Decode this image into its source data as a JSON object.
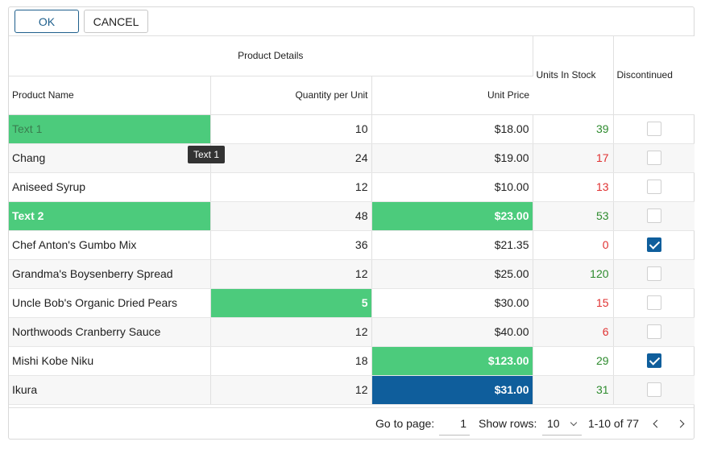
{
  "toolbar": {
    "ok_label": "OK",
    "cancel_label": "CANCEL"
  },
  "header": {
    "group_label": "Product Details",
    "columns": {
      "name": "Product Name",
      "qty": "Quantity per Unit",
      "price": "Unit Price",
      "stock": "Units In Stock",
      "discontinued": "Discontinued"
    }
  },
  "rows": [
    {
      "name": "Text 1",
      "qty": "10",
      "price": "$18.00",
      "stock": "39",
      "discontinued": false
    },
    {
      "name": "Chang",
      "qty": "24",
      "price": "$19.00",
      "stock": "17",
      "discontinued": false
    },
    {
      "name": "Aniseed Syrup",
      "qty": "12",
      "price": "$10.00",
      "stock": "13",
      "discontinued": false
    },
    {
      "name": "Text 2",
      "qty": "48",
      "price": "$23.00",
      "stock": "53",
      "discontinued": false
    },
    {
      "name": "Chef Anton's Gumbo Mix",
      "qty": "36",
      "price": "$21.35",
      "stock": "0",
      "discontinued": true
    },
    {
      "name": "Grandma's Boysenberry Spread",
      "qty": "12",
      "price": "$25.00",
      "stock": "120",
      "discontinued": false
    },
    {
      "name": "Uncle Bob's Organic Dried Pears",
      "qty": "5",
      "price": "$30.00",
      "stock": "15",
      "discontinued": false
    },
    {
      "name": "Northwoods Cranberry Sauce",
      "qty": "12",
      "price": "$40.00",
      "stock": "6",
      "discontinued": false
    },
    {
      "name": "Mishi Kobe Niku",
      "qty": "18",
      "price": "$123.00",
      "stock": "29",
      "discontinued": true
    },
    {
      "name": "Ikura",
      "qty": "12",
      "price": "$31.00",
      "stock": "31",
      "discontinued": false
    }
  ],
  "tooltip": {
    "text": "Text 1"
  },
  "pager": {
    "goto_label": "Go to page:",
    "page_value": "1",
    "rows_label": "Show rows:",
    "rows_value": "10",
    "range_text": "1-10 of 77"
  },
  "colors": {
    "highlight_green": "#4ccb7c",
    "highlight_blue": "#0f5e9c",
    "stock_positive": "#2e8b2e",
    "stock_negative": "#e03131"
  }
}
